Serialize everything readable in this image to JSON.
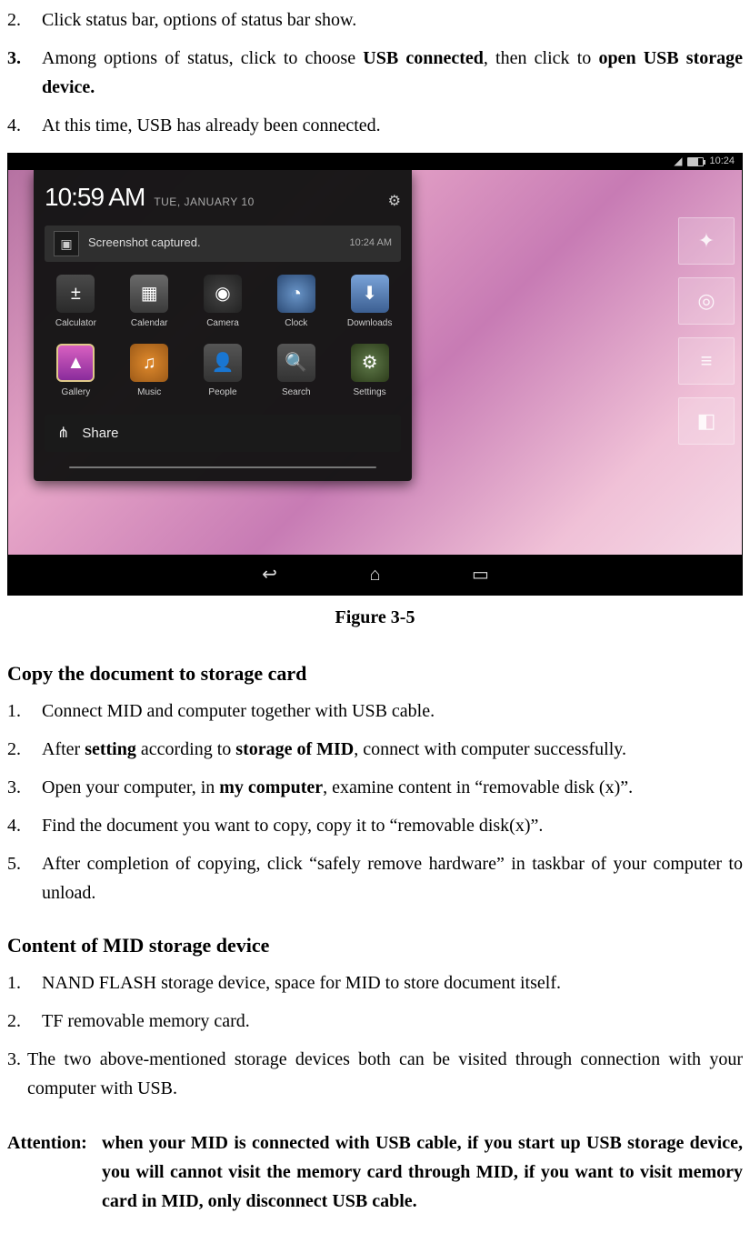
{
  "steps_top": [
    {
      "num": "2.",
      "bold_num": false,
      "pre": "Click status bar, options of status bar show."
    },
    {
      "num": "3.",
      "bold_num": true
    },
    {
      "num": "4.",
      "bold_num": false,
      "pre": "At this time, USB has already been connected."
    }
  ],
  "step3": {
    "a": "Among options of status, click to choose ",
    "b": "USB connected",
    "c": ", then click to ",
    "d": "open USB storage device."
  },
  "figure": {
    "caption": "Figure 3-5",
    "status_time": "10:24",
    "clock_time": "10:59 AM",
    "clock_date": "TUE, JANUARY 10",
    "notif_title": "Screenshot captured.",
    "notif_time": "10:24 AM",
    "apps_row1": [
      "Calculator",
      "Calendar",
      "Camera",
      "Clock",
      "Downloads"
    ],
    "apps_row2": [
      "Gallery",
      "Music",
      "People",
      "Search",
      "Settings"
    ],
    "share_label": "Share"
  },
  "section_copy": {
    "title": "Copy the document to storage card",
    "items": {
      "1": "Connect MID and computer together with USB cable.",
      "2a": "After ",
      "2b": "setting",
      "2c": " according to ",
      "2d": "storage of MID",
      "2e": ", connect with computer successfully.",
      "3a": "Open your computer, in ",
      "3b": "my computer",
      "3c": ", examine content in “removable disk (x)”.",
      "4": "Find the document you want to copy, copy it to “removable disk(x)”.",
      "5": "After completion of copying, click “safely remove hardware” in taskbar of your computer to unload."
    }
  },
  "section_content": {
    "title": "Content of MID storage device",
    "items": {
      "1": "NAND FLASH storage device, space for MID to store document itself.",
      "2": "TF removable memory card.",
      "3": "The two above-mentioned storage devices both can be visited through connection with your computer with USB."
    }
  },
  "attention": {
    "label": "Attention: ",
    "body": "when your MID is connected with USB cable, if you start up USB storage device, you will cannot visit the memory card through MID, if you want to visit memory card in MID, only disconnect USB cable."
  }
}
